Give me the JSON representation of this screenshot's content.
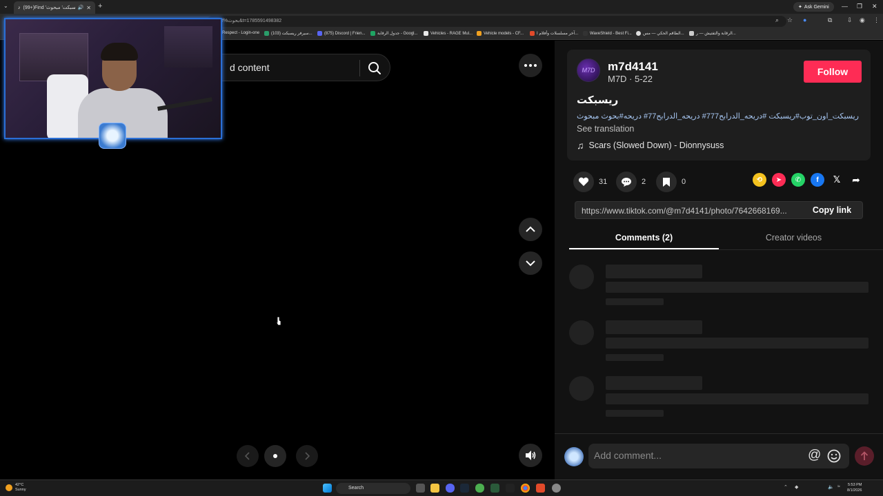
{
  "browser": {
    "tab_title": "(99+)Find 'ريسبكت' مبحوث",
    "new_tab": "+",
    "ask_gemini": "Ask Gemini",
    "url": "f%بحوث&t=1785591498382",
    "bookmarks": [
      "Respect - Login-one",
      "سيرفر ريسبكت (103)...",
      "(875) Discord | Frien...",
      "جدول الرقابة - Googl...",
      "Vehicles - RAGE Mul...",
      "Vehicle models - CF...",
      "آخر مسلسلات وأفلام ا...",
      "WaveShield - Best Fi...",
      "الطاقم الحكي — مس...",
      "الرقابة والتفتيش — ر..."
    ]
  },
  "viewer": {
    "search_text": "d content",
    "colors": {
      "bg": "#000000",
      "button": "#252525"
    }
  },
  "post": {
    "username": "m7d4141",
    "subline": "M7D · 5-22",
    "follow_label": "Follow",
    "caption": "ريسبكت",
    "hashtags": "ريسبكت_اون_توب#ريسبكت #دريحه_الدرابح777# دريحه_الدرابح77# دريحه#بحوث مبحوث",
    "see_translation": "See translation",
    "music": "Scars (Slowed Down) - Dionnysuss",
    "avatar_text": "M7D",
    "likes": "31",
    "comments": "2",
    "saves": "0",
    "share_icons": [
      "repost-icon",
      "send-icon",
      "whatsapp-icon",
      "facebook-icon",
      "x-icon",
      "share-arrow-icon"
    ],
    "link": "https://www.tiktok.com/@m7d4141/photo/7642668169...",
    "copy_link": "Copy link",
    "tab_comments": "Comments (2)",
    "tab_creator": "Creator videos",
    "add_comment_placeholder": "Add comment...",
    "colors": {
      "follow": "#fe2c55",
      "panel": "#121212"
    }
  },
  "taskbar": {
    "temp": "42°C",
    "condition": "Sunny",
    "search": "Search",
    "time": "5:53 PM",
    "date": "8/1/2026"
  }
}
